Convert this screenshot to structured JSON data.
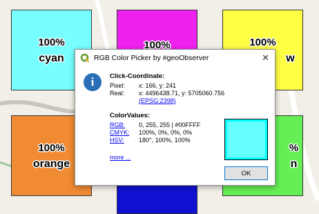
{
  "colors": {
    "cyan": "#77ffff",
    "magenta": "#ee22ee",
    "yellow": "#ffff44",
    "orange": "#f08a33",
    "blue": "#1010d0",
    "green": "#66ee55",
    "swatch": "#00ffff"
  },
  "tiles": [
    {
      "pct": "100%",
      "name": "cyan"
    },
    {
      "pct": "100%",
      "name": ""
    },
    {
      "pct": "100%",
      "name": "w"
    },
    {
      "pct": "100%",
      "name": "orange"
    },
    {
      "pct": "%",
      "name": "n"
    }
  ],
  "dialog": {
    "title": "RGB Color Picker by #geoObserver",
    "close_glyph": "✕",
    "info_glyph": "i",
    "click_heading": "Click-Coordinate:",
    "pixel_label": "Pixel:",
    "pixel_value": "x: 166, y: 241",
    "real_label": "Real:",
    "real_value": "x: 4496438.71, y: 5705060.756",
    "epsg_link": "(EPSG:2398)",
    "color_heading": "ColorValues:",
    "rgb_label": "RGB:",
    "rgb_value": "0, 255, 255 | #00FFFF",
    "cmyk_label": "CMYK:",
    "cmyk_value": "100%, 0%, 0%, 0%",
    "hsv_label": "HSV:",
    "hsv_value": "180°, 100%, 100%",
    "more_link": "more ...",
    "ok_label": "OK"
  }
}
